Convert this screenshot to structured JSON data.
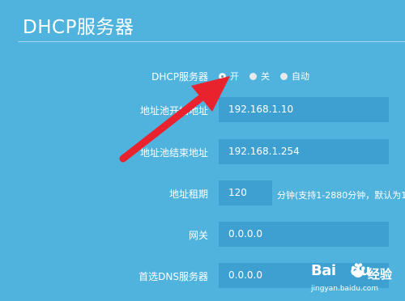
{
  "page": {
    "title": "DHCP服务器"
  },
  "form": {
    "dhcp_label": "DHCP服务器",
    "dhcp_options": [
      {
        "label": "开",
        "checked": true
      },
      {
        "label": "关",
        "checked": false
      },
      {
        "label": "自动",
        "checked": false
      }
    ],
    "start_label": "地址池开始地址",
    "start_value": "192.168.1.10",
    "end_label": "地址池结束地址",
    "end_value": "192.168.1.254",
    "lease_label": "地址租期",
    "lease_value": "120",
    "lease_hint": "分钟(支持1-2880分钟，默认为1",
    "gateway_label": "网关",
    "gateway_value": "0.0.0.0",
    "dns_label": "首选DNS服务器",
    "dns_value": "0.0.0.0"
  },
  "watermark": {
    "brand": "Bai",
    "brand_suffix": "du",
    "cn": "经验",
    "url": "jingyan.baidu.com"
  },
  "colors": {
    "background": "#4fb3dd",
    "field": "#3ea0d1",
    "arrow": "#e8232d"
  }
}
